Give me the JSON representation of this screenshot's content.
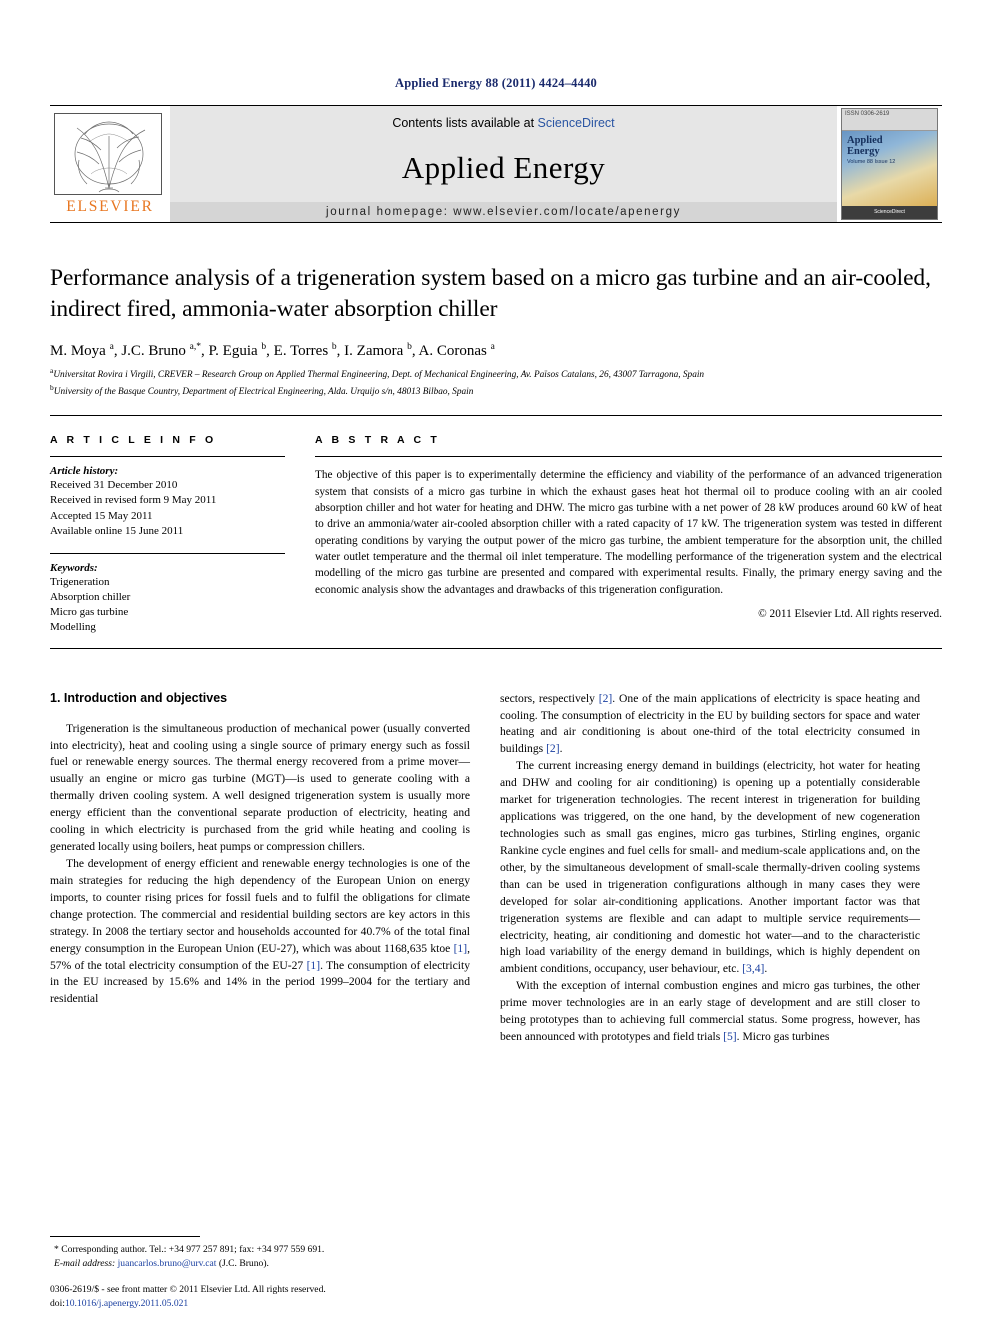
{
  "running_head": "Applied Energy 88 (2011) 4424–4440",
  "banner": {
    "contents_prefix": "Contents lists available at ",
    "sciencedirect": "ScienceDirect",
    "journal_title": "Applied Energy",
    "homepage": "journal homepage: www.elsevier.com/locate/apenergy",
    "publisher_name": "ELSEVIER",
    "cover": {
      "top_label": "ISSN 0306-2619",
      "title_line1": "Applied",
      "title_line2": "Energy",
      "subtitle": "Volume 88  Issue 12",
      "footer": "ScienceDirect"
    }
  },
  "article": {
    "title": "Performance analysis of a trigeneration system based on a micro gas turbine and an air-cooled, indirect fired, ammonia-water absorption chiller",
    "authors_html": "M. Moya <sup>a</sup>, J.C. Bruno <sup>a,*</sup>, P. Eguia <sup>b</sup>, E. Torres <sup>b</sup>, I. Zamora <sup>b</sup>, A. Coronas <sup>a</sup>",
    "affiliation_a": "Universitat Rovira i Virgili, CREVER – Research Group on Applied Thermal Engineering, Dept. of Mechanical Engineering, Av. Països Catalans, 26, 43007 Tarragona, Spain",
    "affiliation_b": "University of the Basque Country, Department of Electrical Engineering, Alda. Urquijo s/n, 48013 Bilbao, Spain"
  },
  "article_info": {
    "heading": "A R T I C L E   I N F O",
    "history_label": "Article history:",
    "history": [
      "Received 31 December 2010",
      "Received in revised form 9 May 2011",
      "Accepted 15 May 2011",
      "Available online 15 June 2011"
    ],
    "keywords_label": "Keywords:",
    "keywords": [
      "Trigeneration",
      "Absorption chiller",
      "Micro gas turbine",
      "Modelling"
    ]
  },
  "abstract": {
    "heading": "A B S T R A C T",
    "text": "The objective of this paper is to experimentally determine the efficiency and viability of the performance of an advanced trigeneration system that consists of a micro gas turbine in which the exhaust gases heat hot thermal oil to produce cooling with an air cooled absorption chiller and hot water for heating and DHW. The micro gas turbine with a net power of 28 kW produces around 60 kW of heat to drive an ammonia/water air-cooled absorption chiller with a rated capacity of 17 kW. The trigeneration system was tested in different operating conditions by varying the output power of the micro gas turbine, the ambient temperature for the absorption unit, the chilled water outlet temperature and the thermal oil inlet temperature. The modelling performance of the trigeneration system and the electrical modelling of the micro gas turbine are presented and compared with experimental results. Finally, the primary energy saving and the economic analysis show the advantages and drawbacks of this trigeneration configuration.",
    "copyright": "© 2011 Elsevier Ltd. All rights reserved."
  },
  "body": {
    "section_title": "1. Introduction and objectives",
    "left_paragraphs": [
      "Trigeneration is the simultaneous production of mechanical power (usually converted into electricity), heat and cooling using a single source of primary energy such as fossil fuel or renewable energy sources. The thermal energy recovered from a prime mover—usually an engine or micro gas turbine (MGT)—is used to generate cooling with a thermally driven cooling system. A well designed trigeneration system is usually more energy efficient than the conventional separate production of electricity, heating and cooling in which electricity is purchased from the grid while heating and cooling is generated locally using boilers, heat pumps or compression chillers.",
      "The development of energy efficient and renewable energy technologies is one of the main strategies for reducing the high dependency of the European Union on energy imports, to counter rising prices for fossil fuels and to fulfil the obligations for climate change protection. The commercial and residential building sectors are key actors in this strategy. In 2008 the tertiary sector and households accounted for 40.7% of the total final energy consumption in the European Union (EU-27), which was about 1168,635 ktoe [1], 57% of the total electricity consumption of the EU-27 [1]. The consumption of electricity in the EU increased by 15.6% and 14% in the period 1999–2004 for the tertiary and residential"
    ],
    "right_paragraphs": [
      "sectors, respectively [2]. One of the main applications of electricity is space heating and cooling. The consumption of electricity in the EU by building sectors for space and water heating and air conditioning is about one-third of the total electricity consumed in buildings [2].",
      "The current increasing energy demand in buildings (electricity, hot water for heating and DHW and cooling for air conditioning) is opening up a potentially considerable market for trigeneration technologies. The recent interest in trigeneration for building applications was triggered, on the one hand, by the development of new cogeneration technologies such as small gas engines, micro gas turbines, Stirling engines, organic Rankine cycle engines and fuel cells for small- and medium-scale applications and, on the other, by the simultaneous development of small-scale thermally-driven cooling systems than can be used in trigeneration configurations although in many cases they were developed for solar air-conditioning applications. Another important factor was that trigeneration systems are flexible and can adapt to multiple service requirements—electricity, heating, air conditioning and domestic hot water—and to the characteristic high load variability of the energy demand in buildings, which is highly dependent on ambient conditions, occupancy, user behaviour, etc. [3,4].",
      "With the exception of internal combustion engines and micro gas turbines, the other prime mover technologies are in an early stage of development and are still closer to being prototypes than to achieving full commercial status. Some progress, however, has been announced with prototypes and field trials [5]. Micro gas turbines"
    ]
  },
  "footnotes": {
    "corresponding": "* Corresponding author. Tel.: +34 977 257 891; fax: +34 977 559 691.",
    "email_label": "E-mail address:",
    "email": "juancarlos.bruno@urv.cat",
    "email_suffix": "(J.C. Bruno).",
    "issn_line": "0306-2619/$ - see front matter © 2011 Elsevier Ltd. All rights reserved.",
    "doi_label": "doi:",
    "doi": "10.1016/j.apenergy.2011.05.021"
  },
  "colors": {
    "link": "#1a3fa0",
    "running_head": "#1a2a6c",
    "elsevier_orange": "#E87722",
    "banner_gray": "#e6e6e6"
  }
}
